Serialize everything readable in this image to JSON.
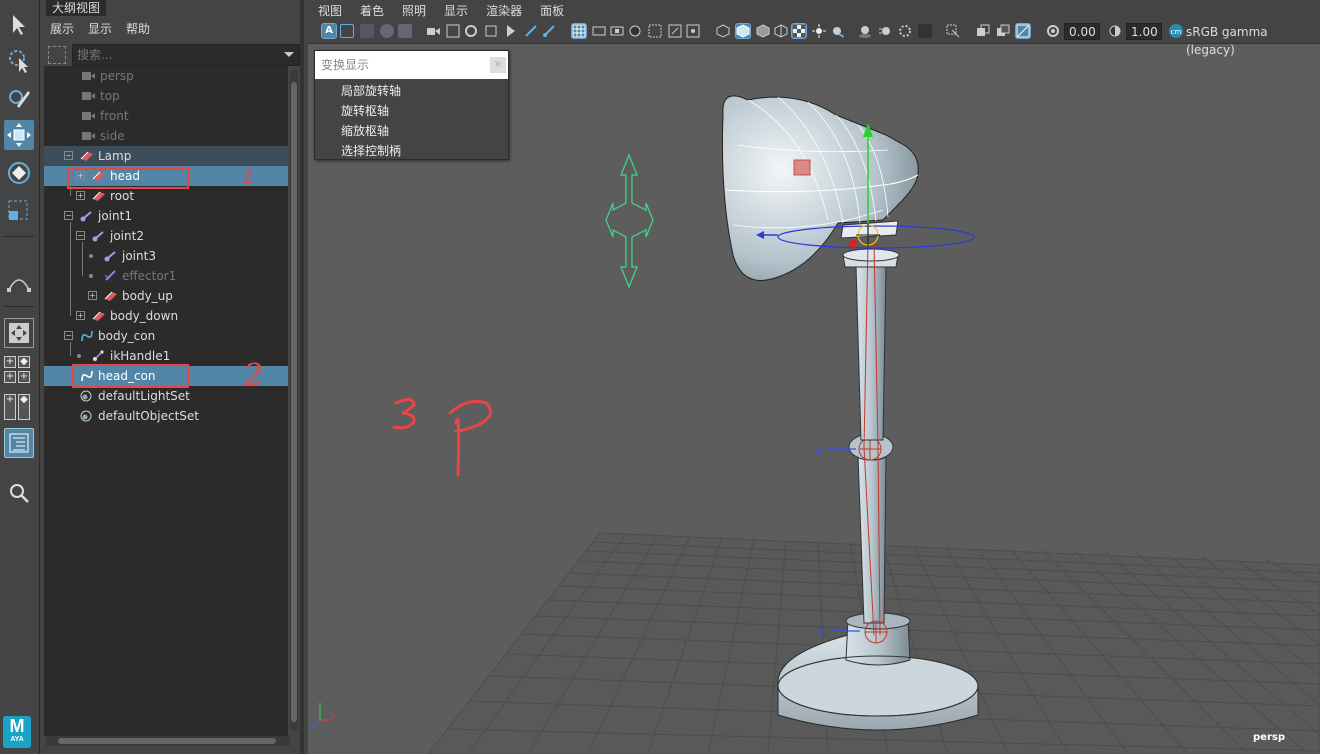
{
  "outliner": {
    "tab_title": "大纲视图",
    "menu": [
      "展示",
      "显示",
      "帮助"
    ],
    "search_placeholder": "搜索...",
    "items": [
      {
        "label": "persp",
        "type": "camera"
      },
      {
        "label": "top",
        "type": "camera"
      },
      {
        "label": "front",
        "type": "camera"
      },
      {
        "label": "side",
        "type": "camera"
      },
      {
        "label": "Lamp",
        "type": "mesh"
      },
      {
        "label": "head",
        "type": "mesh",
        "state": "selected"
      },
      {
        "label": "root",
        "type": "mesh"
      },
      {
        "label": "joint1",
        "type": "joint"
      },
      {
        "label": "joint2",
        "type": "joint"
      },
      {
        "label": "joint3",
        "type": "joint"
      },
      {
        "label": "effector1",
        "type": "effector"
      },
      {
        "label": "body_up",
        "type": "mesh"
      },
      {
        "label": "body_down",
        "type": "mesh"
      },
      {
        "label": "body_con",
        "type": "curve"
      },
      {
        "label": "ikHandle1",
        "type": "ikhandle"
      },
      {
        "label": "head_con",
        "type": "curve",
        "state": "selected"
      },
      {
        "label": "defaultLightSet",
        "type": "set"
      },
      {
        "label": "defaultObjectSet",
        "type": "set"
      }
    ]
  },
  "annotations": {
    "mark_1": "1",
    "mark_2": "2",
    "note": "3 P",
    "color": "#e84545"
  },
  "viewport": {
    "menu": [
      "视图",
      "着色",
      "照明",
      "显示",
      "渲染器",
      "面板"
    ],
    "exposure": "0.00",
    "gamma": "1.00",
    "color_space": "sRGB gamma (legacy)",
    "camera_label": "persp",
    "axis_z": "z",
    "gnomon": {
      "x": "x",
      "y": "y",
      "z": "z"
    }
  },
  "popup_menu": {
    "header": "变换显示",
    "close": "×",
    "items": [
      "局部旋转轴",
      "旋转枢轴",
      "缩放枢轴",
      "选择控制柄"
    ]
  },
  "app": {
    "logo_letter": "M",
    "logo_sub": "AYA",
    "accent": "#5285a6"
  }
}
